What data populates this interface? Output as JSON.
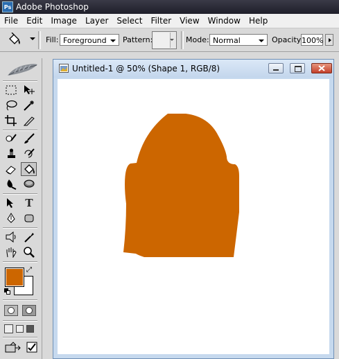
{
  "window": {
    "title": "Adobe Photoshop"
  },
  "menu": [
    "File",
    "Edit",
    "Image",
    "Layer",
    "Select",
    "Filter",
    "View",
    "Window",
    "Help"
  ],
  "options": {
    "tool_icon": "paint-bucket-icon",
    "fill_label": "Fill:",
    "fill_value": "Foreground",
    "pattern_label": "Pattern:",
    "mode_label": "Mode:",
    "mode_value": "Normal",
    "opacity_label": "Opacity:",
    "opacity_value": "100%"
  },
  "toolbox": {
    "foreground_color": "#cc6600",
    "background_color": "#ffffff",
    "type_tool_glyph": "T"
  },
  "document": {
    "title": "Untitled-1 @ 50% (Shape 1, RGB/8)",
    "canvas_color": "#ffffff",
    "shape_color": "#cc6600"
  }
}
